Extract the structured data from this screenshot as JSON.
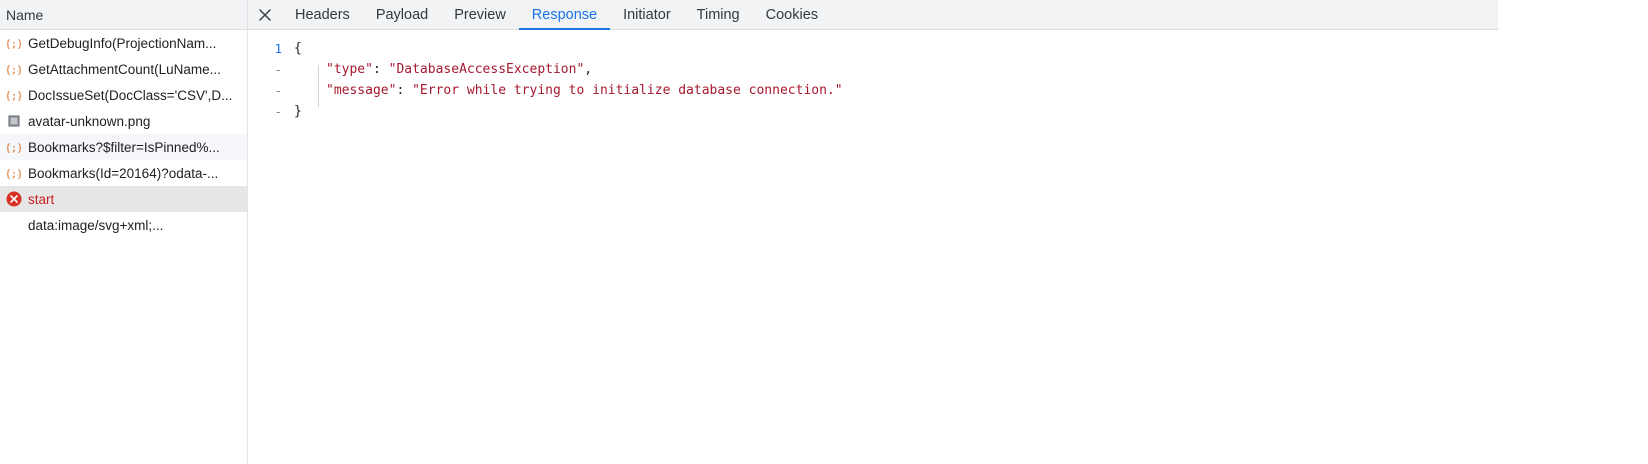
{
  "request_list": {
    "header": "Name",
    "items": [
      {
        "label": "GetDebugInfo(ProjectionNam...",
        "icon": "xhr-icon"
      },
      {
        "label": "GetAttachmentCount(LuName...",
        "icon": "xhr-icon"
      },
      {
        "label": "DocIssueSet(DocClass='CSV',D...",
        "icon": "xhr-icon"
      },
      {
        "label": "avatar-unknown.png",
        "icon": "image-icon"
      },
      {
        "label": "Bookmarks?$filter=IsPinned%...",
        "icon": "xhr-icon"
      },
      {
        "label": "Bookmarks(Id=20164)?odata-...",
        "icon": "xhr-icon"
      },
      {
        "label": "start",
        "icon": "error-icon"
      },
      {
        "label": "data:image/svg+xml;...",
        "icon": "none"
      }
    ]
  },
  "detail": {
    "close_icon": "close-icon",
    "tabs": [
      {
        "label": "Headers"
      },
      {
        "label": "Payload"
      },
      {
        "label": "Preview"
      },
      {
        "label": "Response",
        "active": true
      },
      {
        "label": "Initiator"
      },
      {
        "label": "Timing"
      },
      {
        "label": "Cookies"
      }
    ],
    "response": {
      "lines": [
        {
          "gutter": "1",
          "text": "{"
        },
        {
          "gutter": "-",
          "key": "\"type\"",
          "colon": ": ",
          "value": "\"DatabaseAccessException\"",
          "trail": ","
        },
        {
          "gutter": "-",
          "key": "\"message\"",
          "colon": ": ",
          "value": "\"Error while trying to initialize database connection.\"",
          "trail": ""
        },
        {
          "gutter": "-",
          "text": "}"
        }
      ]
    }
  },
  "colors": {
    "accent": "#1a73e8",
    "error": "#d93025",
    "string": "#a6192e",
    "xhr_icon": "#d56b1f"
  }
}
